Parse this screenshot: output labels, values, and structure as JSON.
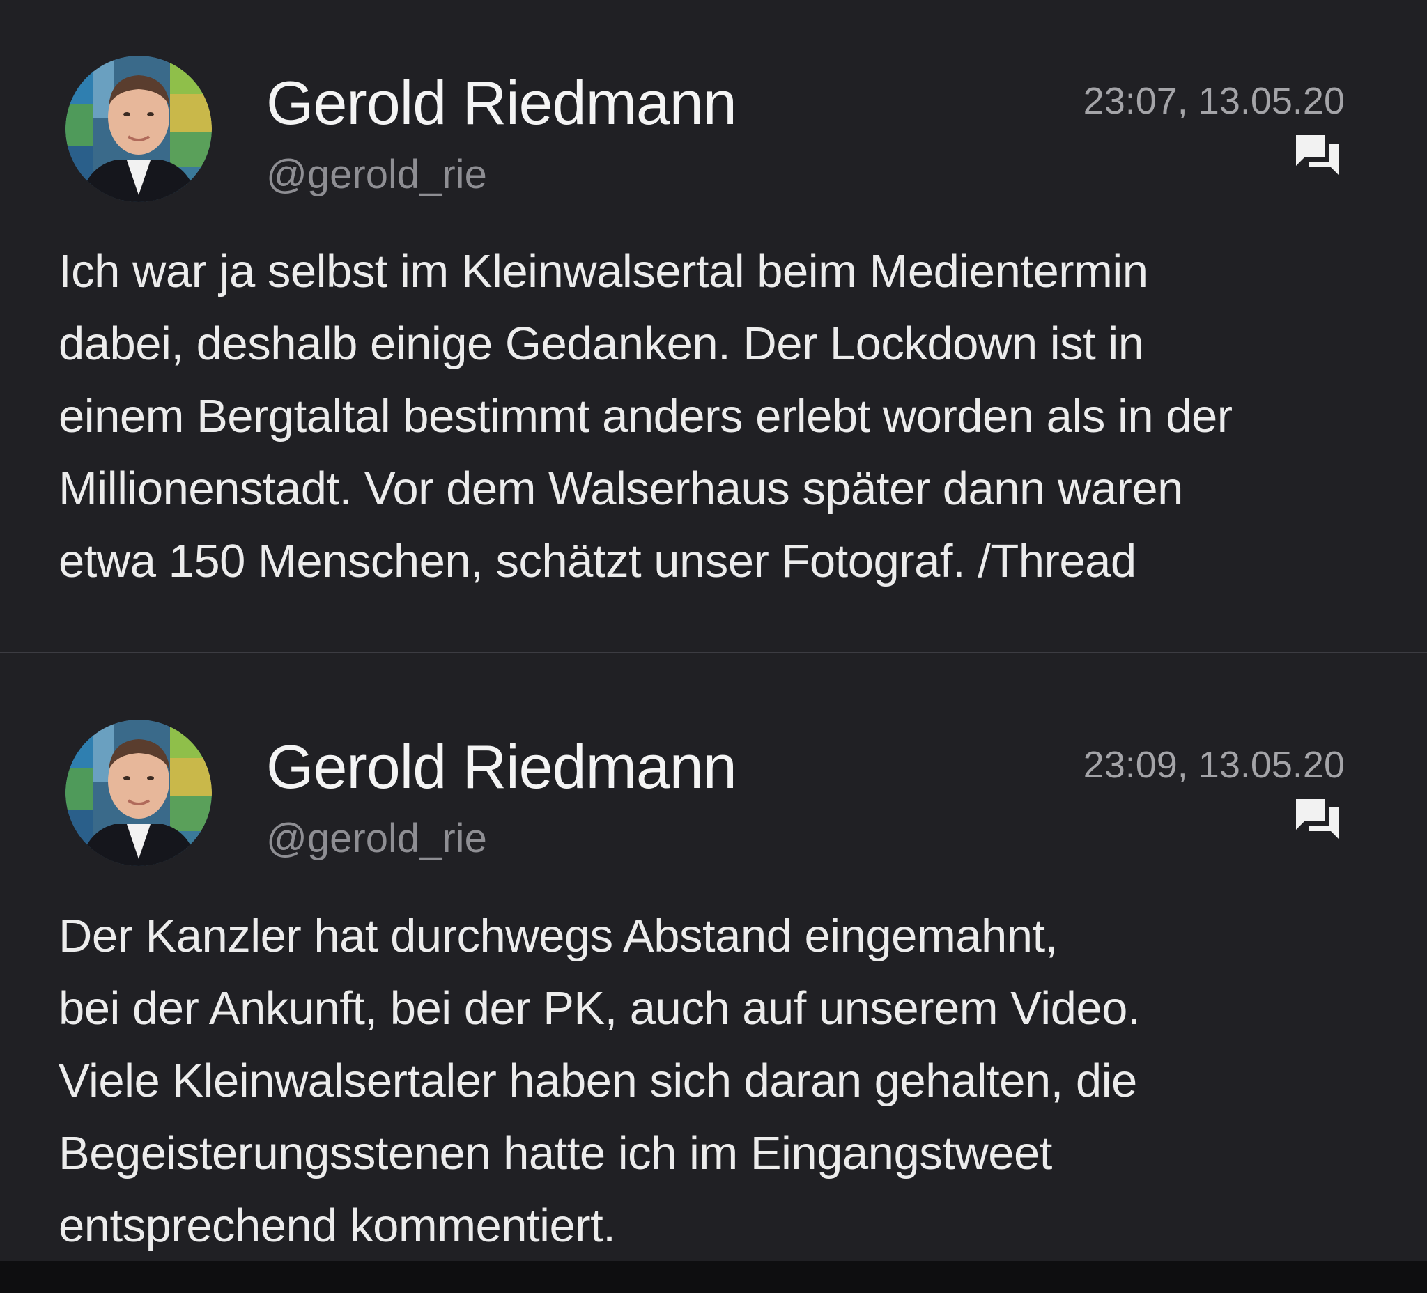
{
  "colors": {
    "background": "#202024",
    "name_text": "#f4f4f4",
    "handle_text": "#8e8e93",
    "timestamp_text": "#a4a4a8",
    "body_text": "#ececec",
    "divider": "#3c3c42"
  },
  "tweets": [
    {
      "display_name": "Gerold Riedmann",
      "handle": "@gerold_rie",
      "timestamp": "23:07, 13.05.20",
      "reply_icon": "forum-icon",
      "avatar_icon": "profile-photo",
      "text_lines": [
        "Ich war ja selbst im Kleinwalsertal beim Medientermin",
        "dabei, deshalb einige Gedanken. Der Lockdown ist in",
        "einem Bergtaltal bestimmt anders erlebt worden als in der",
        "Millionenstadt. Vor dem Walserhaus später dann waren",
        "etwa 150 Menschen, schätzt unser Fotograf. /Thread"
      ]
    },
    {
      "display_name": "Gerold Riedmann",
      "handle": "@gerold_rie",
      "timestamp": "23:09, 13.05.20",
      "reply_icon": "forum-icon",
      "avatar_icon": "profile-photo",
      "text_lines": [
        "Der Kanzler hat durchwegs Abstand eingemahnt,",
        "bei der Ankunft, bei der PK, auch auf unserem Video.",
        "Viele Kleinwalsertaler haben sich daran gehalten, die",
        "Begeisterungsstenen hatte ich im Eingangstweet",
        "entsprechend kommentiert."
      ]
    }
  ]
}
